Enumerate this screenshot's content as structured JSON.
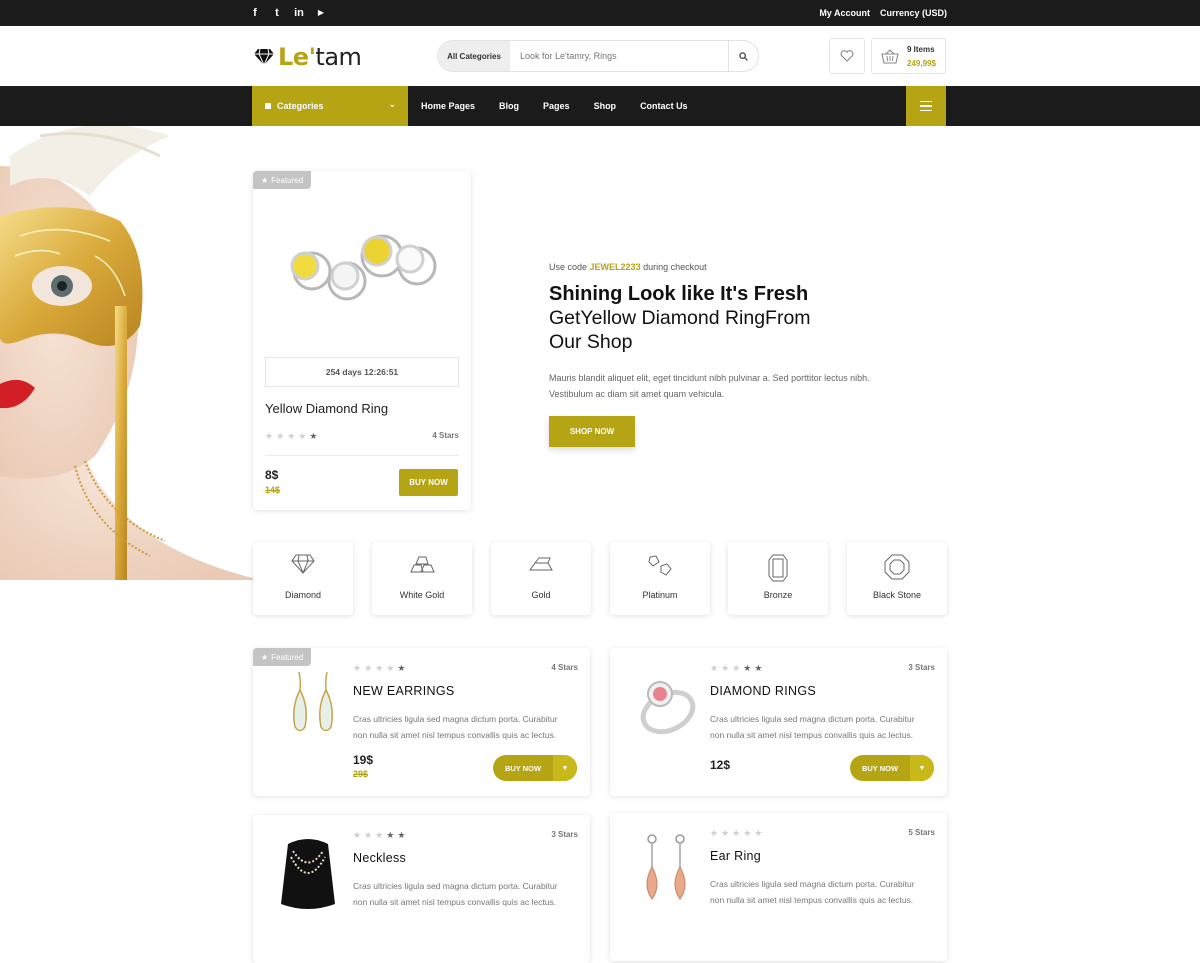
{
  "colors": {
    "accent": "#b5a414",
    "dark": "#1b1b1b"
  },
  "topbar": {
    "social": [
      {
        "icon": "facebook-icon",
        "glyph": "f"
      },
      {
        "icon": "twitter-icon",
        "glyph": "t"
      },
      {
        "icon": "linkedin-icon",
        "glyph": "in"
      },
      {
        "icon": "youtube-icon",
        "glyph": "▶"
      }
    ],
    "my_account": "My Account",
    "currency": "Currency (USD)"
  },
  "header": {
    "logo_accent": "Le'",
    "logo_rest": "tam",
    "search_category": "All Categories",
    "search_placeholder": "Look for Le'tamry, Rings",
    "cart_items": "9 Items",
    "cart_total": "249,99$"
  },
  "nav": {
    "categories_label": "Categories",
    "links": [
      "Home Pages",
      "Blog",
      "Pages",
      "Shop",
      "Contact Us"
    ]
  },
  "featured_product": {
    "badge": "Featured",
    "countdown": "254 days 12:26:51",
    "name": "Yellow Diamond Ring",
    "stars": 4,
    "rating_label": "4 Stars",
    "price": "8$",
    "old_price": "14$",
    "buy_label": "BUY NOW"
  },
  "promo": {
    "code_prefix": "Use code",
    "code": "JEWEL2233",
    "code_suffix": "during checkout",
    "headline": "Shining Look like It's Fresh",
    "subline_1": "GetYellow Diamond RingFrom",
    "subline_2": "Our Shop",
    "body_1": "Mauris blandit aliquet elit, eget tincidunt nibh pulvinar a. Sed porttitor lectus nibh.",
    "body_2": "Vestibulum ac diam sit amet quam vehicula.",
    "button": "SHOP NOW"
  },
  "categories": [
    {
      "label": "Diamond",
      "icon": "diamond-icon"
    },
    {
      "label": "White Gold",
      "icon": "gold-bars-icon"
    },
    {
      "label": "Gold",
      "icon": "gold-ingot-icon"
    },
    {
      "label": "Platinum",
      "icon": "platinum-icon"
    },
    {
      "label": "Bronze",
      "icon": "gem-icon"
    },
    {
      "label": "Black Stone",
      "icon": "octagon-gem-icon"
    }
  ],
  "products": [
    {
      "badge": "Featured",
      "stars": 4,
      "rating_label": "4 Stars",
      "title": "NEW EARRINGS",
      "desc_1": "Cras ultricies ligula sed magna dictum porta. Curabitur",
      "desc_2": "non nulla sit amet nisl tempus convallis quis ac lectus.",
      "price": "19$",
      "old_price": "29$",
      "buy_label": "BUY NOW"
    },
    {
      "stars": 3,
      "rating_label": "3 Stars",
      "title": "DIAMOND RINGS",
      "desc_1": "Cras ultricies ligula sed magna dictum porta. Curabitur",
      "desc_2": "non nulla sit amet nisl tempus convallis quis ac lectus.",
      "price": "12$",
      "buy_label": "BUY NOW"
    },
    {
      "stars": 3,
      "rating_label": "3 Stars",
      "title": "Neckless",
      "desc_1": "Cras ultricies ligula sed magna dictum porta. Curabitur",
      "desc_2": "non nulla sit amet nisl tempus convallis quis ac lectus."
    },
    {
      "stars": 5,
      "rating_label": "5 Stars",
      "title": "Ear Ring",
      "desc_1": "Cras ultricies ligula sed magna dictum porta. Curabitur",
      "desc_2": "non nulla sit amet nisl tempus convallis quis ac lectus."
    }
  ]
}
